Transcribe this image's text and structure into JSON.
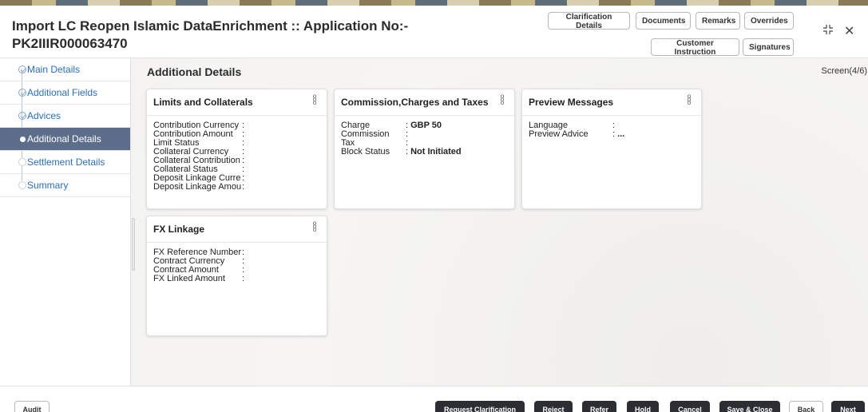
{
  "header": {
    "title": "Import LC Reopen Islamic DataEnrichment :: Application No:- PK2IIIR000063470",
    "buttons": {
      "clarification_details": "Clarification Details",
      "documents": "Documents",
      "remarks": "Remarks",
      "overrides": "Overrides",
      "customer_instruction": "Customer Instruction",
      "signatures": "Signatures"
    },
    "icons": {
      "minimize": "compress-icon",
      "close": "close-icon"
    }
  },
  "sidebar": {
    "items": [
      {
        "label": "Main Details",
        "state": "done"
      },
      {
        "label": "Additional Fields",
        "state": "done"
      },
      {
        "label": "Advices",
        "state": "done"
      },
      {
        "label": "Additional Details",
        "state": "active"
      },
      {
        "label": "Settlement Details",
        "state": "todo"
      },
      {
        "label": "Summary",
        "state": "todo"
      }
    ]
  },
  "main": {
    "section_title": "Additional Details",
    "screen_indicator": "Screen(4/6)",
    "cards": {
      "limits": {
        "title": "Limits and Collaterals",
        "rows": [
          {
            "label": "Contribution Currency",
            "value": ""
          },
          {
            "label": "Contribution Amount",
            "value": ""
          },
          {
            "label": "Limit Status",
            "value": ""
          },
          {
            "label": "Collateral Currency",
            "value": ""
          },
          {
            "label": "Collateral Contribution",
            "value": ""
          },
          {
            "label": "Collateral Status",
            "value": ""
          },
          {
            "label": "Deposit Linkage Currency",
            "value": ""
          },
          {
            "label": "Deposit Linkage Amount",
            "value": ""
          }
        ]
      },
      "commission": {
        "title": "Commission,Charges and Taxes",
        "rows": [
          {
            "label": "Charge",
            "value": "GBP 50"
          },
          {
            "label": "Commission",
            "value": ""
          },
          {
            "label": "Tax",
            "value": ""
          },
          {
            "label": "Block Status",
            "value": "Not Initiated"
          }
        ]
      },
      "preview": {
        "title": "Preview Messages",
        "rows": [
          {
            "label": "Language",
            "value": ""
          },
          {
            "label": "Preview Advice",
            "value": "..."
          }
        ]
      },
      "fx": {
        "title": "FX Linkage",
        "rows": [
          {
            "label": "FX Reference Number",
            "value": ""
          },
          {
            "label": "Contract Currency",
            "value": ""
          },
          {
            "label": "Contract Amount",
            "value": ""
          },
          {
            "label": "FX Linked Amount",
            "value": ""
          }
        ]
      }
    }
  },
  "footer": {
    "audit": "Audit",
    "request_clarification": "Request Clarification",
    "reject": "Reject",
    "refer": "Refer",
    "hold": "Hold",
    "cancel": "Cancel",
    "save_close": "Save & Close",
    "back": "Back",
    "next": "Next"
  },
  "colors": {
    "sidebar_active_bg": "#5d6e8c",
    "link_blue": "#2a6ebb",
    "dark_button": "#2b2f33"
  }
}
